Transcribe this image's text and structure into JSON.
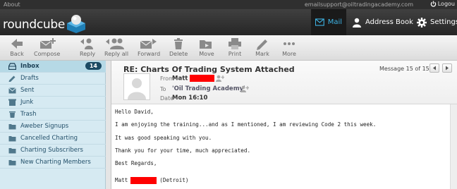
{
  "topbar": {
    "about": "About",
    "user_email": "emailsupport@oiltradingacademy.com",
    "logout": "Logou"
  },
  "header": {
    "logo_text": "roundcube",
    "nav": [
      {
        "label": "Mail",
        "icon": "mail-icon",
        "active": true
      },
      {
        "label": "Address Book",
        "icon": "address-book-icon",
        "active": false
      },
      {
        "label": "Settings",
        "icon": "gear-icon",
        "active": false
      }
    ]
  },
  "toolbar": {
    "back": "Back",
    "compose": "Compose",
    "reply": "Reply",
    "reply_all": "Reply all",
    "forward": "Forward",
    "delete": "Delete",
    "move": "Move",
    "print": "Print",
    "mark": "Mark",
    "more": "More"
  },
  "folders": [
    {
      "label": "Inbox",
      "icon": "inbox-icon",
      "count": "14",
      "selected": true
    },
    {
      "label": "Drafts",
      "icon": "pencil-icon"
    },
    {
      "label": "Sent",
      "icon": "sent-icon"
    },
    {
      "label": "Junk",
      "icon": "junk-icon"
    },
    {
      "label": "Trash",
      "icon": "trash-icon"
    },
    {
      "label": "Aweber Signups",
      "icon": "folder-icon"
    },
    {
      "label": "Cancelled Charting",
      "icon": "folder-icon"
    },
    {
      "label": "Charting Subscribers",
      "icon": "folder-icon"
    },
    {
      "label": "New Charting Members",
      "icon": "folder-icon"
    }
  ],
  "message": {
    "subject": "RE: Charts Of Trading System Attached",
    "counter": "Message 15 of 15",
    "from_label": "From",
    "from_value": "Matt",
    "to_label": "To",
    "to_value": "'Oil Trading Academy'",
    "date_label": "Date",
    "date_value": "Mon 16:10",
    "body": [
      "Hello David,",
      "I am enjoying the training...and as I mentioned, I am reviewing Code 2 this week.",
      "It was good speaking with you.",
      "Thank you for your time, much appreciated.",
      "Best Regards,"
    ],
    "signature_name": "Matt",
    "signature_city": "(Detroit)"
  },
  "colors": {
    "accent": "#3fb5e6",
    "folder_bg": "#d6eaf2",
    "redaction": "#ff0000"
  }
}
